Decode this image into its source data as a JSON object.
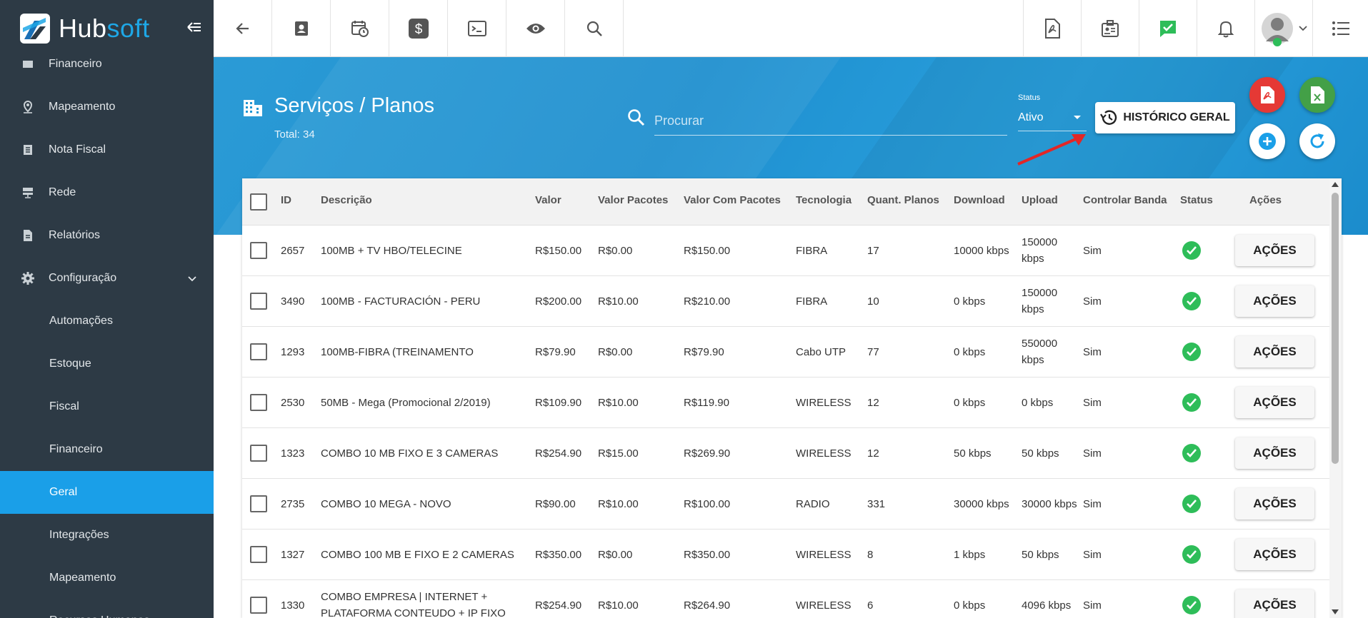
{
  "app": {
    "logo_main": "Hub",
    "logo_accent": "soft"
  },
  "sidebar": {
    "items": [
      {
        "label": "Financeiro",
        "icon": "money-icon"
      },
      {
        "label": "Mapeamento",
        "icon": "map-pin-icon"
      },
      {
        "label": "Nota Fiscal",
        "icon": "receipt-icon"
      },
      {
        "label": "Rede",
        "icon": "server-icon"
      },
      {
        "label": "Relatórios",
        "icon": "document-icon"
      },
      {
        "label": "Configuração",
        "icon": "gear-icon"
      }
    ],
    "subitems": [
      {
        "label": "Automações"
      },
      {
        "label": "Estoque"
      },
      {
        "label": "Fiscal"
      },
      {
        "label": "Financeiro"
      },
      {
        "label": "Geral",
        "active": true
      },
      {
        "label": "Integrações"
      },
      {
        "label": "Mapeamento"
      },
      {
        "label": "Recursos Humanos"
      }
    ]
  },
  "header": {
    "title": "Serviços / Planos",
    "total": "Total: 34",
    "search_placeholder": "Procurar",
    "status_label": "Status",
    "status_value": "Ativo",
    "history_button": "HISTÓRICO GERAL"
  },
  "table": {
    "columns": [
      "ID",
      "Descrição",
      "Valor",
      "Valor Pacotes",
      "Valor Com Pacotes",
      "Tecnologia",
      "Quant. Planos",
      "Download",
      "Upload",
      "Controlar Banda",
      "Status",
      "Ações"
    ],
    "action_label": "AÇÕES",
    "rows": [
      {
        "id": "2657",
        "desc": "100MB + TV HBO/TELECINE",
        "valor": "R$150.00",
        "pacotes": "R$0.00",
        "com": "R$150.00",
        "tec": "FIBRA",
        "qtd": "17",
        "down": "10000 kbps",
        "up": "150000 kbps",
        "banda": "Sim"
      },
      {
        "id": "3490",
        "desc": "100MB - FACTURACIÓN - PERU",
        "valor": "R$200.00",
        "pacotes": "R$10.00",
        "com": "R$210.00",
        "tec": "FIBRA",
        "qtd": "10",
        "down": "0 kbps",
        "up": "150000 kbps",
        "banda": "Sim"
      },
      {
        "id": "1293",
        "desc": "100MB-FIBRA (TREINAMENTO",
        "valor": "R$79.90",
        "pacotes": "R$0.00",
        "com": "R$79.90",
        "tec": "Cabo UTP",
        "qtd": "77",
        "down": "0 kbps",
        "up": "550000 kbps",
        "banda": "Sim"
      },
      {
        "id": "2530",
        "desc": "50MB - Mega (Promocional 2/2019)",
        "valor": "R$109.90",
        "pacotes": "R$10.00",
        "com": "R$119.90",
        "tec": "WIRELESS",
        "qtd": "12",
        "down": "0 kbps",
        "up": "0 kbps",
        "banda": "Sim"
      },
      {
        "id": "1323",
        "desc": "COMBO 10 MB FIXO E 3 CAMERAS",
        "valor": "R$254.90",
        "pacotes": "R$15.00",
        "com": "R$269.90",
        "tec": "WIRELESS",
        "qtd": "12",
        "down": "50 kbps",
        "up": "50 kbps",
        "banda": "Sim"
      },
      {
        "id": "2735",
        "desc": "COMBO 10 MEGA - NOVO",
        "valor": "R$90.00",
        "pacotes": "R$10.00",
        "com": "R$100.00",
        "tec": "RADIO",
        "qtd": "331",
        "down": "30000 kbps",
        "up": "30000 kbps",
        "banda": "Sim"
      },
      {
        "id": "1327",
        "desc": "COMBO 100 MB E FIXO E 2 CAMERAS",
        "valor": "R$350.00",
        "pacotes": "R$0.00",
        "com": "R$350.00",
        "tec": "WIRELESS",
        "qtd": "8",
        "down": "1 kbps",
        "up": "50 kbps",
        "banda": "Sim"
      },
      {
        "id": "1330",
        "desc": "COMBO EMPRESA | INTERNET + PLATAFORMA CONTEUDO + IP FIXO",
        "valor": "R$254.90",
        "pacotes": "R$10.00",
        "com": "R$264.90",
        "tec": "WIRELESS",
        "qtd": "6",
        "down": "0 kbps",
        "up": "4096 kbps",
        "banda": "Sim"
      }
    ]
  },
  "colors": {
    "sidebar": "#2d3a45",
    "active": "#1a9fe8",
    "band": "#2196d3",
    "ok": "#2ebd59",
    "pdf": "#e53935",
    "excel": "#43a047"
  }
}
